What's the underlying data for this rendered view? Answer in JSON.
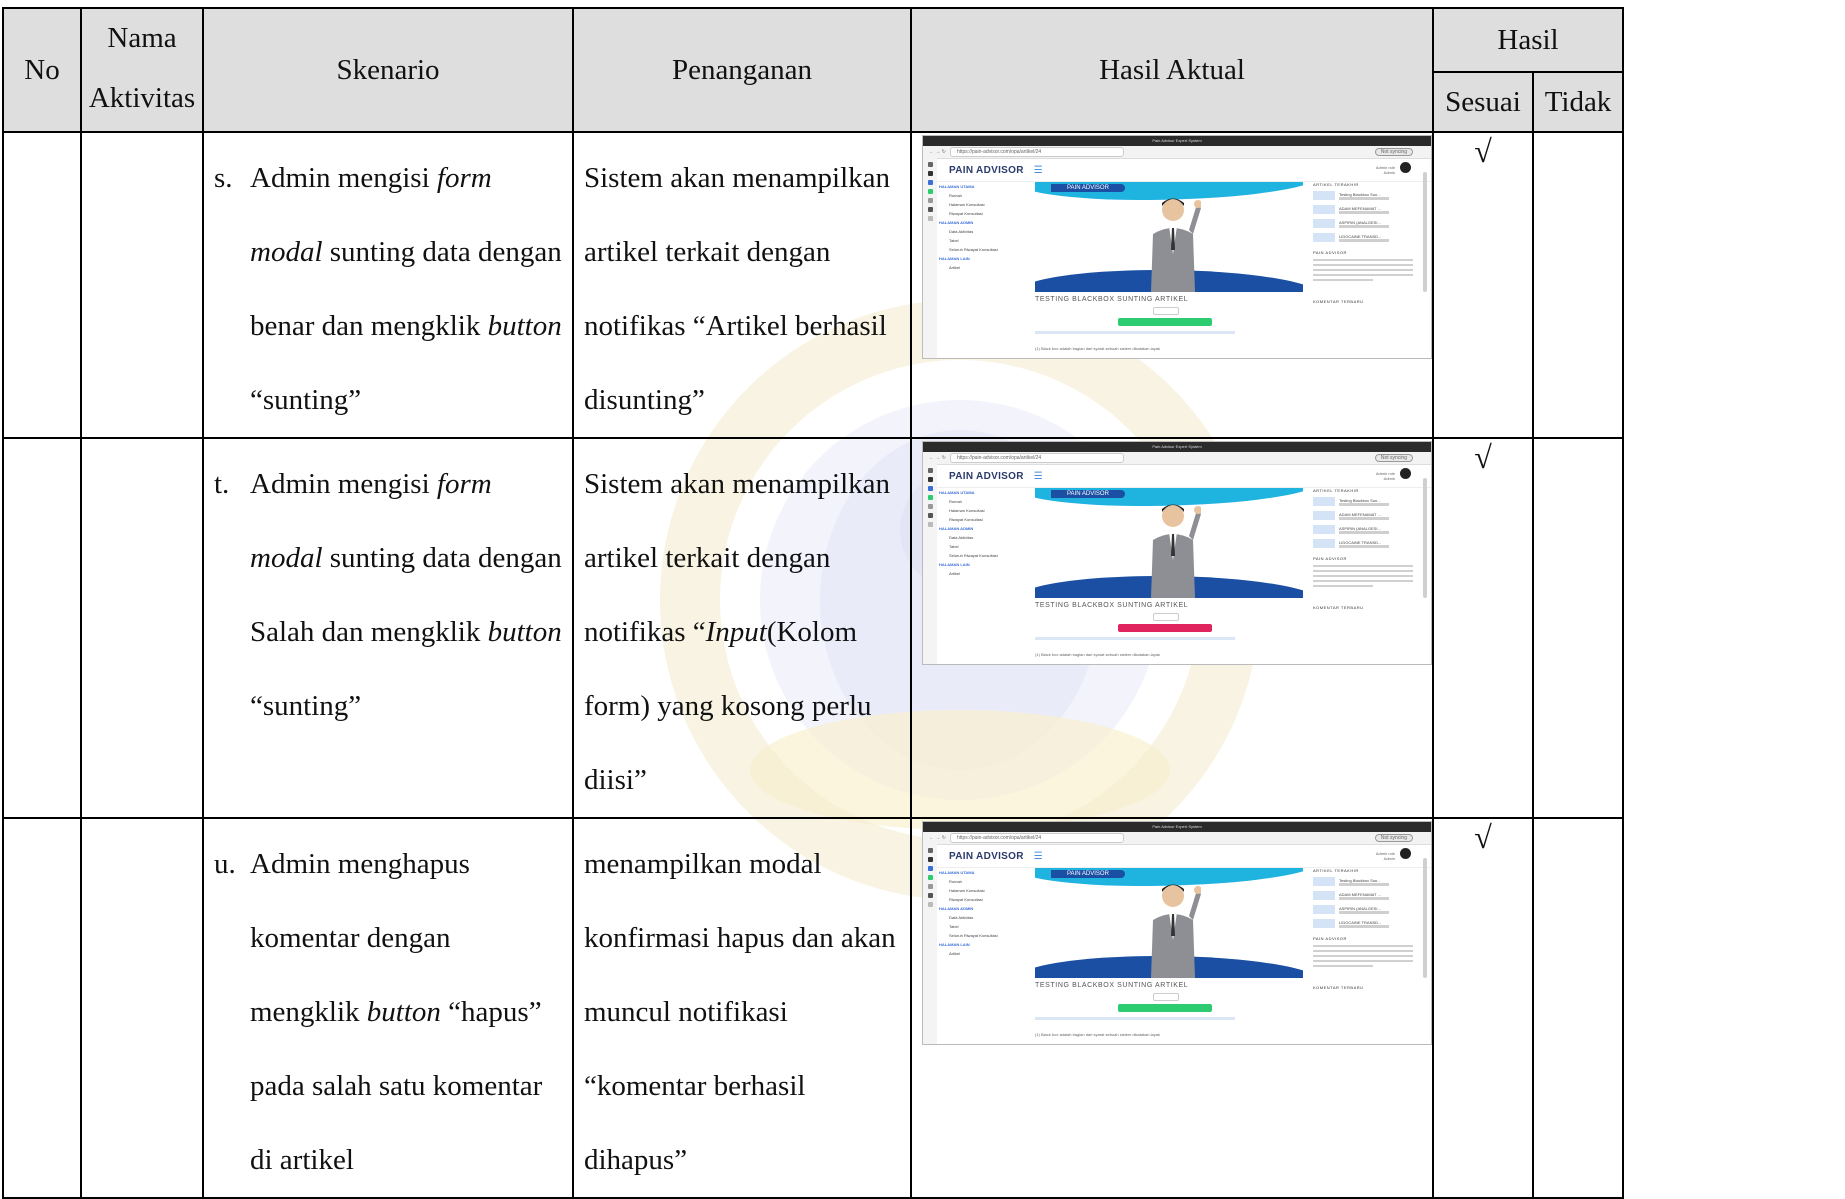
{
  "headers": {
    "no": "No",
    "nama_line1": "Nama",
    "nama_line2": "Aktivitas",
    "skenario": "Skenario",
    "penanganan": "Penanganan",
    "hasil_aktual": "Hasil Aktual",
    "hasil": "Hasil",
    "sesuai": "Sesuai",
    "tidak": "Tidak"
  },
  "rows": [
    {
      "label": "s.",
      "skenario": [
        "Admin mengisi ",
        "form modal",
        " sunting data dengan benar dan mengklik ",
        "button",
        " “sunting”"
      ],
      "penanganan": [
        "Sistem akan menampilkan artikel terkait dengan notifikas “Artikel berhasil disunting”"
      ],
      "check": "√",
      "notif_color": "#2ecc71"
    },
    {
      "label": "t.",
      "skenario": [
        "Admin mengisi ",
        "form modal",
        " sunting data dengan Salah dan mengklik ",
        "button",
        " “sunting”"
      ],
      "penanganan": [
        "Sistem akan menampilkan artikel terkait dengan notifikas “",
        "Input",
        "(Kolom form) yang kosong perlu diisi”"
      ],
      "check": "√",
      "notif_color": "#e0245e"
    },
    {
      "label": "u.",
      "skenario": [
        "Admin menghapus komentar dengan mengklik ",
        "button",
        " “hapus” pada salah satu komentar di artikel"
      ],
      "penanganan": [
        "menampilkan modal konfirmasi hapus dan akan muncul notifikasi “komentar berhasil dihapus”"
      ],
      "check": "√",
      "notif_color": "#2ecc71"
    }
  ],
  "screenshot": {
    "window_title": "Pain Advisor Expert System",
    "url": "https://pain-advisor.com/opa/artikel/24",
    "sync_label": "Not syncing",
    "brand": "PAIN ADVISOR",
    "role_line1": "Admin role",
    "role_line2": "Admin",
    "sidebar": [
      {
        "type": "h",
        "text": "HALAMAN UTAMA"
      },
      {
        "type": "i",
        "text": "Rumah"
      },
      {
        "type": "i",
        "text": "Halaman Konsultasi"
      },
      {
        "type": "i",
        "text": "Riwayat Konsultasi"
      },
      {
        "type": "h",
        "text": "HALAMAN ADMIN"
      },
      {
        "type": "i",
        "text": "Data Aktivitas"
      },
      {
        "type": "i",
        "text": "Tabel"
      },
      {
        "type": "i",
        "text": "Seluruh Riwayat Konsultasi"
      },
      {
        "type": "h",
        "text": "HALAMAN LAIN"
      },
      {
        "type": "i",
        "text": "Artikel"
      }
    ],
    "hero_tag": "PAIN ADVISOR",
    "article_title": "TESTING BLACKBOX SUNTING ARTIKEL",
    "footer_text": "(1) Black box adalah bagian dari syarat sebuah sistem dikatakan layak",
    "right_header": "ARTIKEL TERAKHIR",
    "right_items": [
      "Testing Blackbox Sun...",
      "ADAM MEFENAMAT ...",
      "ASPIRIN (ANALGESI...",
      "LIDOCAINE TRANSD..."
    ],
    "right_section": "PAIN ADVISOR",
    "right_footer": "KOMENTAR TERBARU"
  },
  "colors": {
    "header_bg": "#d9d9d9",
    "brand": "#2a3a6b",
    "hero_light": "#1fb3e0",
    "hero_dark": "#1a4fa3"
  }
}
